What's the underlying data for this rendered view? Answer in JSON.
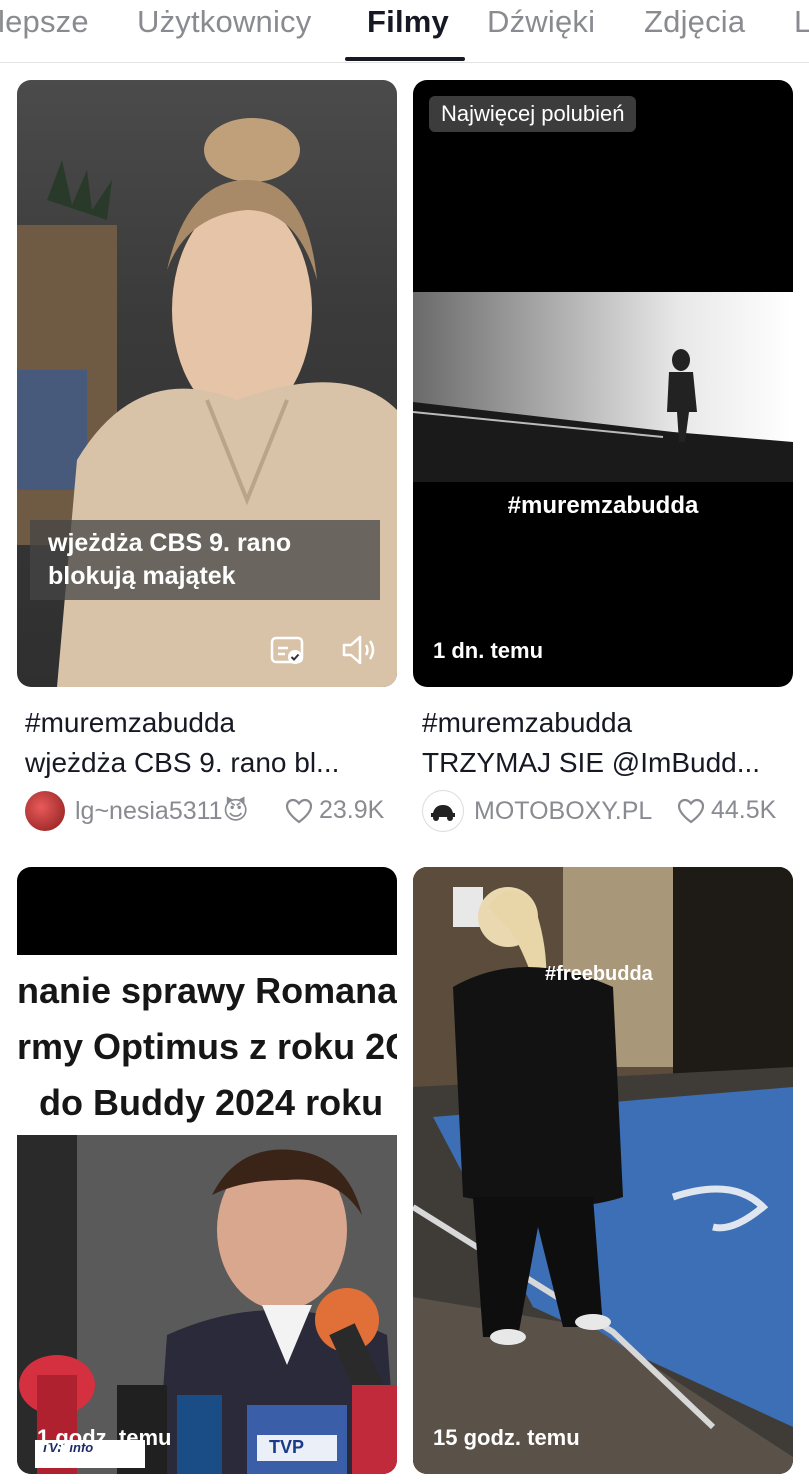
{
  "tabs": [
    "lepsze",
    "Użytkownicy",
    "Filmy",
    "Dźwięki",
    "Zdjęcia",
    "L"
  ],
  "active_tab": "Filmy",
  "videos": [
    {
      "overlay_text": [
        "wjeżdża CBS 9. rano",
        "blokują majątek"
      ],
      "caption_line1": "#muremzabudda",
      "caption_line2": "wjeżdża CBS 9. rano bl...",
      "author": "lg~nesia5311😈",
      "likes": "23.9K"
    },
    {
      "badge": "Najwięcej polubień",
      "overlay_text": "#muremzabudda",
      "time_ago": "1 dn. temu",
      "caption_line1": "#muremzabudda",
      "caption_line2": "TRZYMAJ SIE @ImBudd...",
      "author": "MOTOBOXY.PL",
      "likes": "44.5K"
    },
    {
      "overlay_lines": [
        "nanie sprawy Romana",
        "rmy Optimus z roku 2C",
        "do Buddy 2024 roku"
      ],
      "time_ago": "1 godz. temu",
      "mic_labels": [
        "TVP info",
        "TVP"
      ]
    },
    {
      "overlay_text": "#freebudda",
      "time_ago": "15 godz. temu"
    }
  ]
}
